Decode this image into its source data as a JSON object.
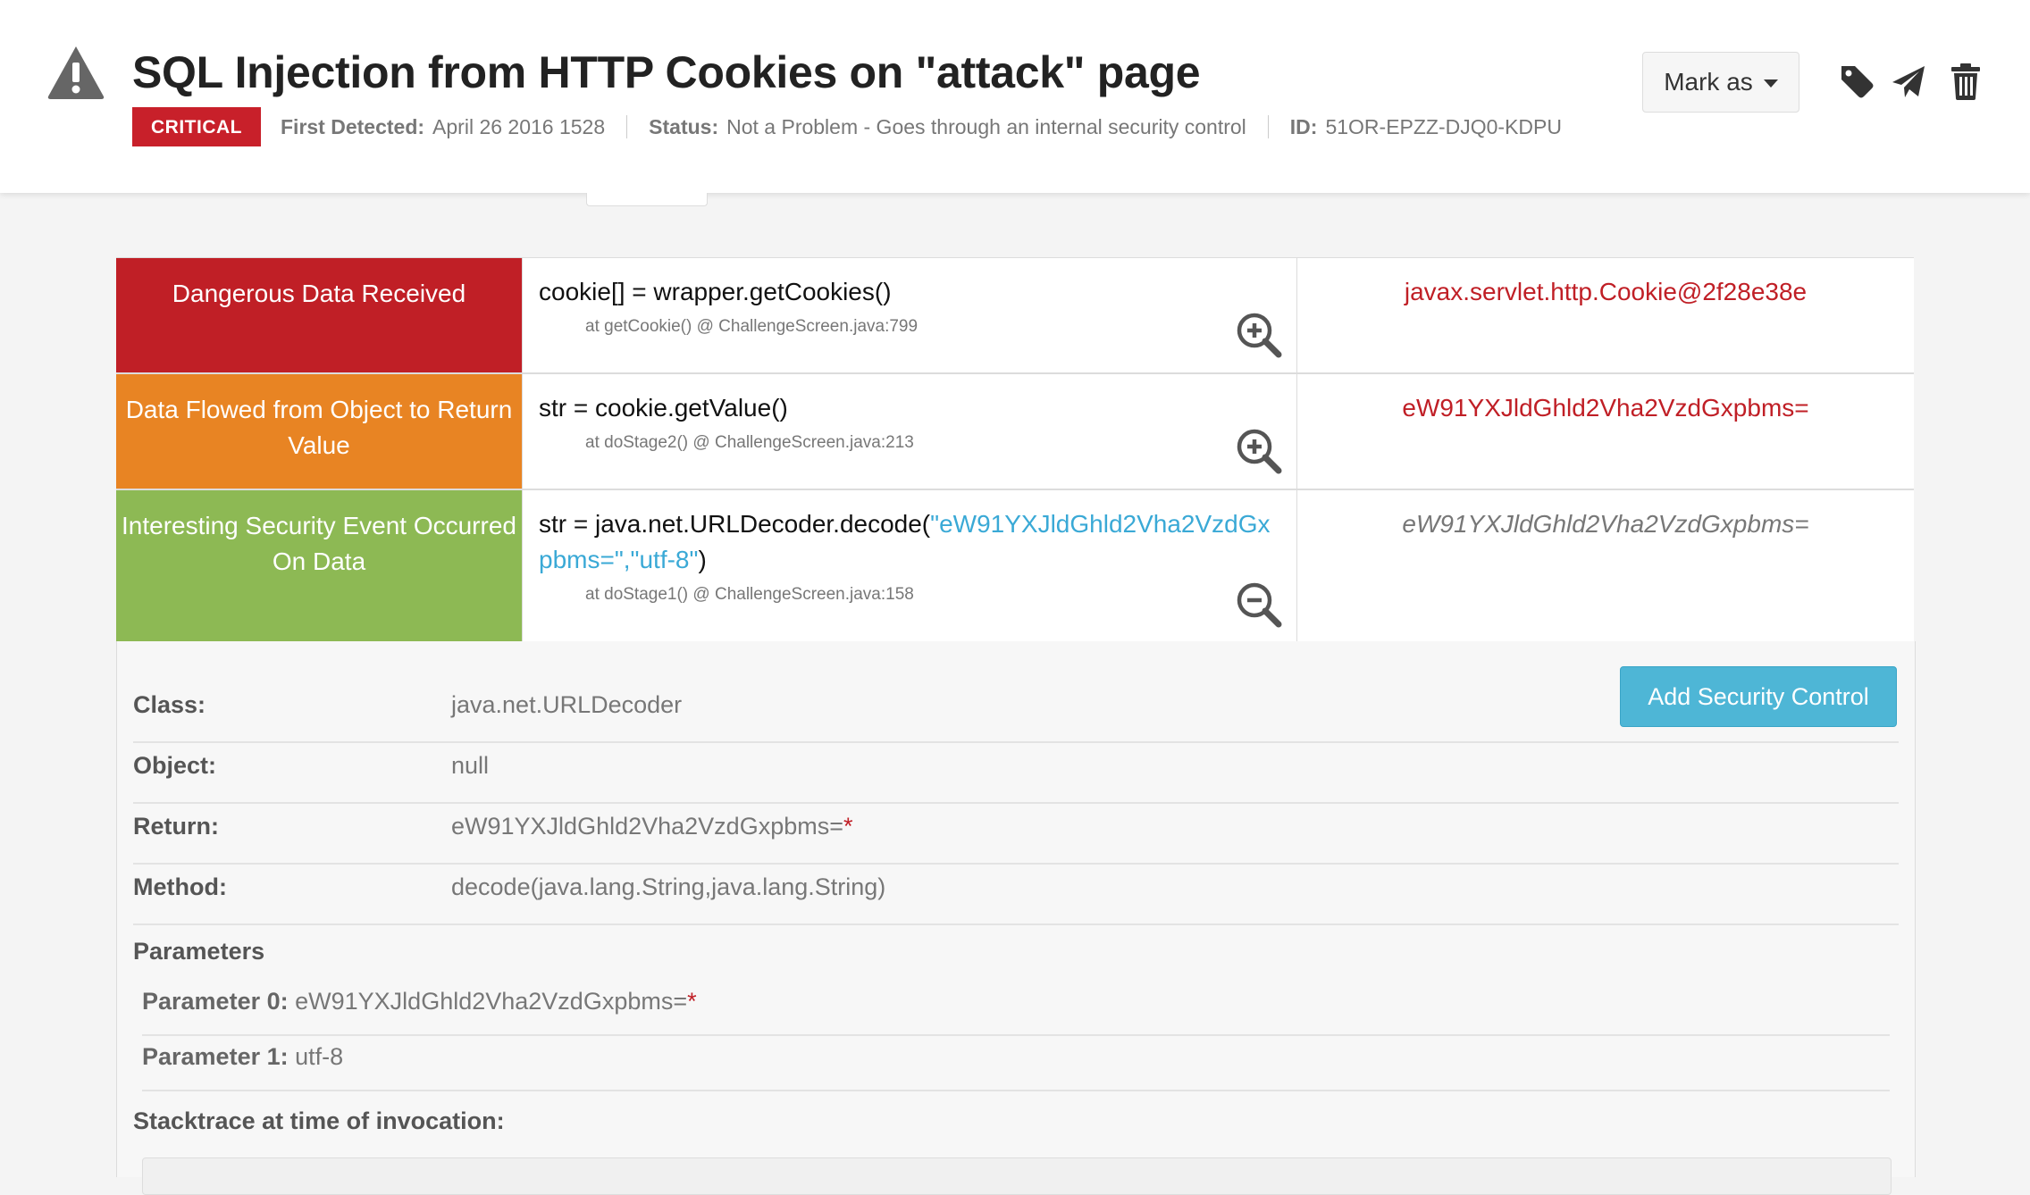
{
  "header": {
    "title": "SQL Injection from HTTP Cookies on \"attack\" page",
    "severity": "CRITICAL",
    "first_detected_label": "First Detected:",
    "first_detected_value": "April 26 2016 1528",
    "status_label": "Status:",
    "status_value": "Not a Problem - Goes through an internal security control",
    "id_label": "ID:",
    "id_value": "51OR-EPZZ-DJQ0-KDPU",
    "mark_as_label": "Mark as",
    "icons": [
      "warning-icon",
      "tag-icon",
      "send-icon",
      "trash-icon"
    ]
  },
  "flow": [
    {
      "label": "Dangerous Data Received",
      "color": "#c01f26",
      "code": "cookie[] = wrapper.getCookies()",
      "location": "at getCookie() @ ChallengeScreen.java:799",
      "value": "javax.servlet.http.Cookie@2f28e38e",
      "zoom": "zoom-in-icon"
    },
    {
      "label": "Data Flowed from Object to Return Value",
      "color": "#e88423",
      "code": "str = cookie.getValue()",
      "location": "at doStage2() @ ChallengeScreen.java:213",
      "value": "eW91YXJldGhld2Vha2VzdGxpbms=",
      "zoom": "zoom-in-icon"
    },
    {
      "label": "Interesting Security Event Occurred On Data",
      "color": "#8db954",
      "code_prefix": "str = java.net.URLDecoder.decode(",
      "code_args": "\"eW91YXJldGhld2Vha2VzdGxpbms=\",\"utf-8\"",
      "code_suffix": ")",
      "location": "at doStage1() @ ChallengeScreen.java:158",
      "value": "eW91YXJldGhld2Vha2VzdGxpbms=",
      "zoom": "zoom-out-icon"
    }
  ],
  "details": {
    "add_control_label": "Add Security Control",
    "class_label": "Class:",
    "class_value": "java.net.URLDecoder",
    "object_label": "Object:",
    "object_value": "null",
    "return_label": "Return:",
    "return_value": "eW91YXJldGhld2Vha2VzdGxpbms=",
    "method_label": "Method:",
    "method_value": "decode(java.lang.String,java.lang.String)",
    "parameters_title": "Parameters",
    "parameters": [
      {
        "label": "Parameter 0:",
        "value": "eW91YXJldGhld2Vha2VzdGxpbms="
      },
      {
        "label": "Parameter 1:",
        "value": "utf-8"
      }
    ],
    "star": "*",
    "stacktrace_title": "Stacktrace at time of invocation:"
  },
  "colors": {
    "critical": "#c8202a",
    "accent_blue": "#4eb6d6",
    "value_red": "#c01f26"
  }
}
